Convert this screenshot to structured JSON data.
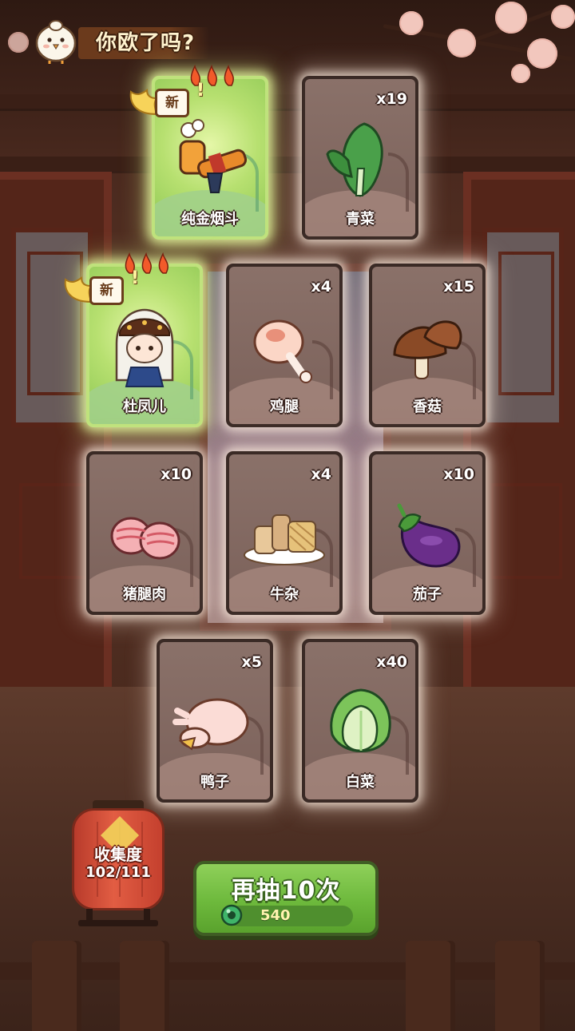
{
  "header": {
    "title": "你欧了吗?"
  },
  "cards": [
    {
      "name": "纯金烟斗",
      "count": "",
      "is_new": true,
      "new_label": "新",
      "art": "golden-pipe-icon"
    },
    {
      "name": "青菜",
      "count": "x19",
      "is_new": false,
      "art": "bok-choy-icon"
    },
    {
      "name": "杜凤儿",
      "count": "",
      "is_new": true,
      "new_label": "新",
      "art": "character-portrait-icon"
    },
    {
      "name": "鸡腿",
      "count": "x4",
      "is_new": false,
      "art": "chicken-leg-icon"
    },
    {
      "name": "香菇",
      "count": "x15",
      "is_new": false,
      "art": "mushroom-icon"
    },
    {
      "name": "猪腿肉",
      "count": "x10",
      "is_new": false,
      "art": "pork-leg-icon"
    },
    {
      "name": "牛杂",
      "count": "x4",
      "is_new": false,
      "art": "beef-offal-icon"
    },
    {
      "name": "茄子",
      "count": "x10",
      "is_new": false,
      "art": "eggplant-icon"
    },
    {
      "name": "鸭子",
      "count": "x5",
      "is_new": false,
      "art": "duck-icon"
    },
    {
      "name": "白菜",
      "count": "x40",
      "is_new": false,
      "art": "napa-cabbage-icon"
    }
  ],
  "collection": {
    "label": "收集度",
    "value": "102/111"
  },
  "draw_again": {
    "label": "再抽10次",
    "cost": "540",
    "currency_icon": "jade-coin-icon"
  },
  "colors": {
    "new_card": "#bfe27c",
    "normal_card": "#8a7169",
    "button_green": "#6db93c",
    "lantern_red": "#e25d43"
  }
}
